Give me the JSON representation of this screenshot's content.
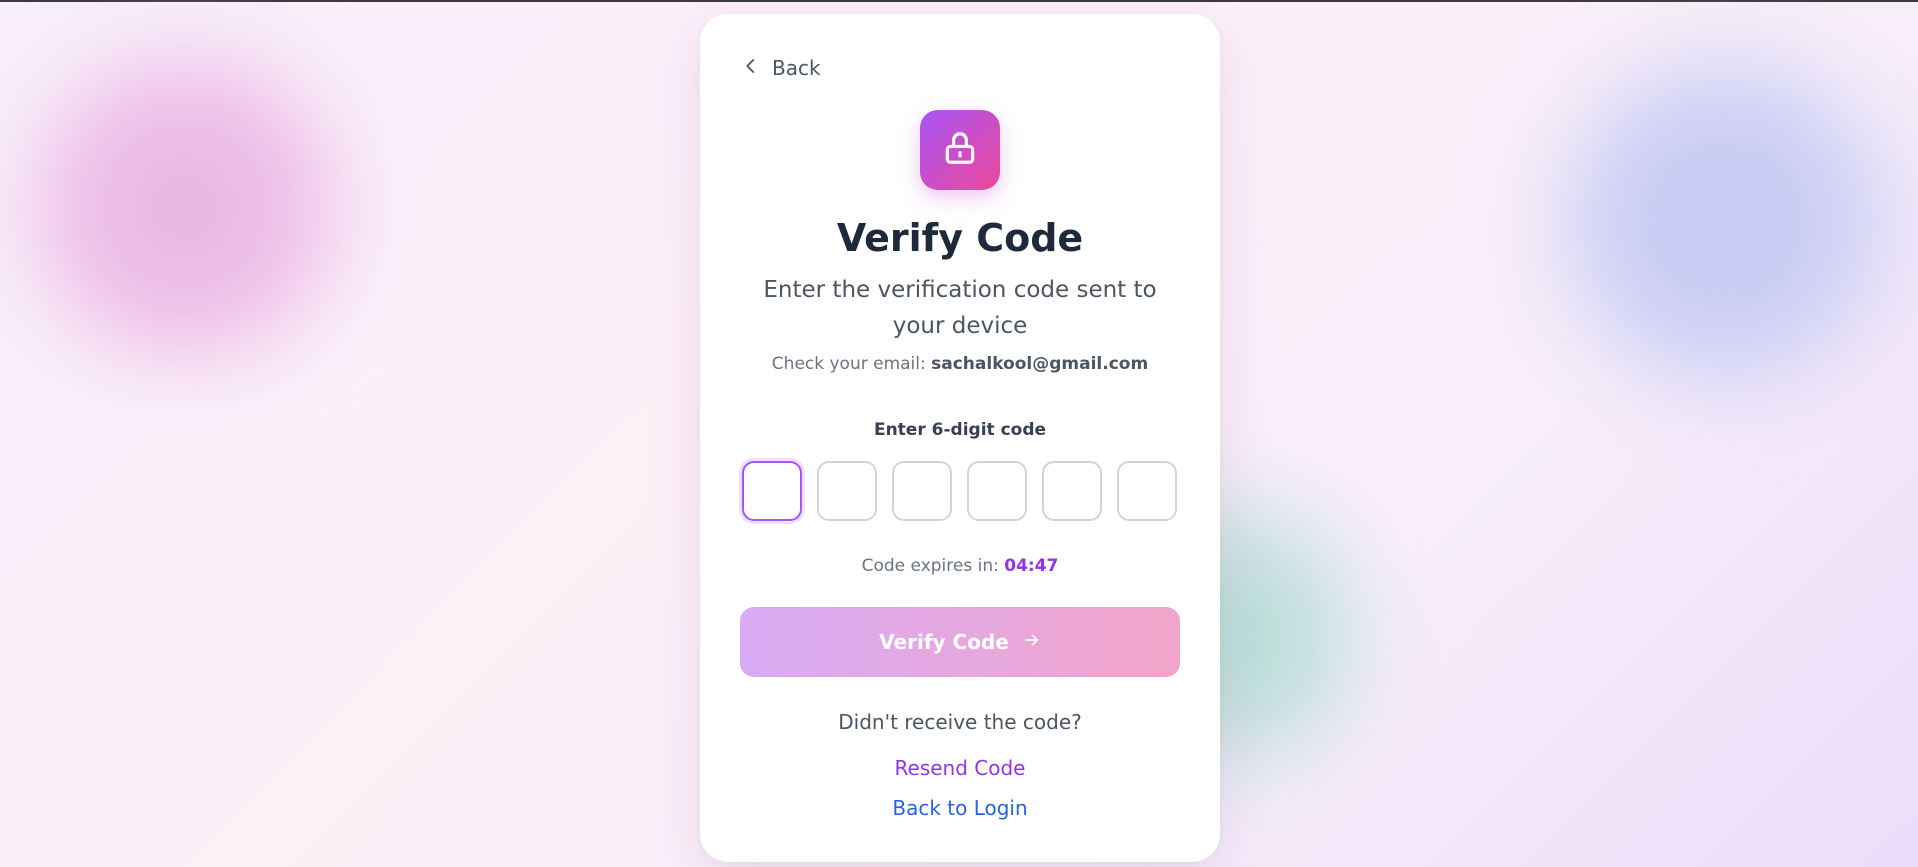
{
  "nav": {
    "back_label": "Back"
  },
  "header": {
    "icon": "lock-icon",
    "title": "Verify Code",
    "subtitle": "Enter the verification code sent to your device",
    "email_prefix": "Check your email: ",
    "email": "sachalkool@gmail.com"
  },
  "code": {
    "label": "Enter 6-digit code",
    "digits": [
      "",
      "",
      "",
      "",
      "",
      ""
    ],
    "expires_prefix": "Code expires in: ",
    "timer": "04:47"
  },
  "actions": {
    "verify_label": "Verify Code",
    "didnt_receive": "Didn't receive the code?",
    "resend_label": "Resend Code",
    "back_to_login_label": "Back to Login"
  },
  "colors": {
    "accent_purple": "#9333ea",
    "accent_pink": "#ec4899",
    "link_blue": "#2563eb",
    "title": "#1e293b"
  }
}
